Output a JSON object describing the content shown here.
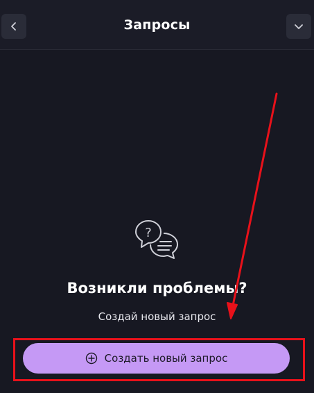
{
  "header": {
    "title": "Запросы",
    "back_icon": "chevron-left-icon",
    "dropdown_icon": "chevron-down-icon"
  },
  "empty_state": {
    "icon": "chat-question-icon",
    "title": "Возникли проблемы?",
    "subtitle": "Создай новый запрос"
  },
  "create_button": {
    "label": "Создать новый запрос",
    "icon": "plus-circle-icon"
  },
  "colors": {
    "background": "#171822",
    "accent": "#c599f5",
    "annotation": "#e8111a"
  }
}
